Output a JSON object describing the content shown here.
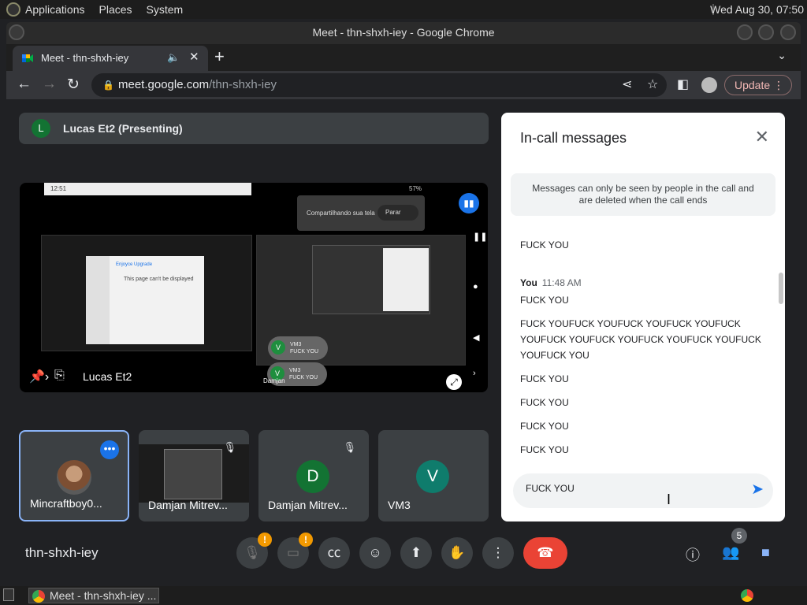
{
  "desktop": {
    "menus": [
      "Applications",
      "Places",
      "System"
    ],
    "clock": "Wed Aug 30, 07:50",
    "task_label": "Meet - thn-shxh-iey ..."
  },
  "browser": {
    "window_title": "Meet - thn-shxh-iey - Google Chrome",
    "tab_title": "Meet - thn-shxh-iey",
    "url_host": "meet.google.com",
    "url_path": "/thn-shxh-iey",
    "update_label": "Update"
  },
  "meet": {
    "presenter": {
      "initial": "L",
      "label": "Lucas Et2 (Presenting)"
    },
    "stage": {
      "name": "Lucas Et2",
      "phone_time": "12:51",
      "phone_battery": "57%",
      "share_text": "Compartilhando sua tela",
      "stop_label": "Parar",
      "screen_heading": "This page can't be displayed",
      "site_name": "Enjoyce Upgrade",
      "chips": [
        {
          "initial": "V",
          "name": "VM3",
          "text": "FUCK YOU"
        },
        {
          "initial": "V",
          "name": "VM3",
          "text": "FUCK YOU"
        }
      ],
      "sub_name": "Damjan"
    },
    "tiles": [
      {
        "name": "Mincraftboy0...",
        "initial": ""
      },
      {
        "name": "Damjan Mitrev...",
        "initial": ""
      },
      {
        "name": "Damjan Mitrev...",
        "initial": "D",
        "color": "#137333"
      },
      {
        "name": "VM3",
        "initial": "V",
        "color": "#0f7c6c"
      }
    ],
    "meeting_code": "thn-shxh-iey",
    "people_count": "5"
  },
  "chat": {
    "title": "In-call messages",
    "notice": "Messages can only be seen by people in the call and are deleted when the call ends",
    "sender": "You",
    "time": "11:48 AM",
    "messages": [
      "FUCK YOU",
      "FUCK YOU",
      "FUCK YOUFUCK YOUFUCK YOUFUCK YOUFUCK YOUFUCK YOUFUCK YOUFUCK YOUFUCK YOUFUCK YOUFUCK YOU",
      "FUCK YOU",
      "FUCK YOU",
      "FUCK YOU",
      "FUCK YOU"
    ],
    "draft": "FUCK YOU"
  }
}
